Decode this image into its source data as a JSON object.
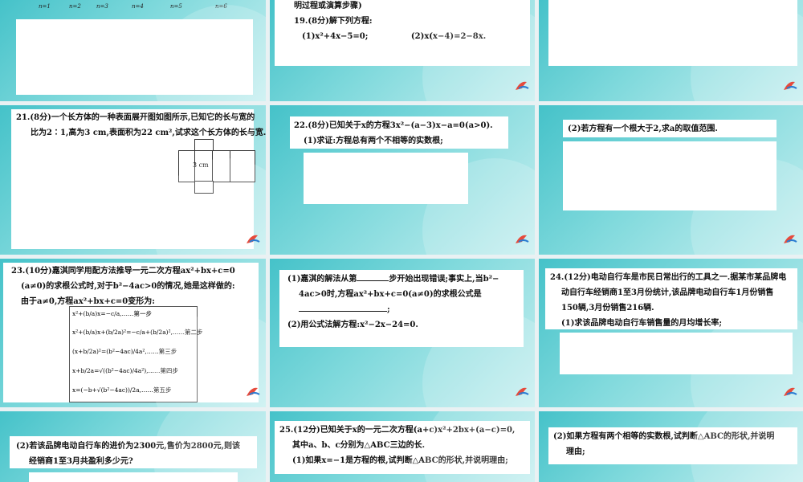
{
  "slide1": {
    "n_labels": [
      "n=1",
      "n=2",
      "n=3",
      "n=4",
      "n=5",
      "n=6"
    ]
  },
  "slide2": {
    "line1": "明过程或演算步骤)",
    "q19": "19.(8分)解下列方程:",
    "q19_1": "(1)x²+4x−5=0;",
    "q19_2": "(2)x(x−4)=2−8x."
  },
  "slide4": {
    "q21_l1": "21.(8分)一个长方体的一种表面展开图如图所示,已知它的长与宽的",
    "q21_l2": "比为2∶1,高为3 cm,表面积为22 cm²,试求这个长方体的长与宽.",
    "fig_label": "3 cm"
  },
  "slide5": {
    "q22": "22.(8分)已知关于x的方程3x²−(a−3)x−a=0(a>0).",
    "q22_1": "(1)求证:方程总有两个不相等的实数根;"
  },
  "slide6": {
    "q22_2": "(2)若方程有一个根大于2,求a的取值范围."
  },
  "slide7": {
    "q23_l1": "23.(10分)嘉淇同学用配方法推导一元二次方程ax²+bx+c=0",
    "q23_l2": "(a≠0)的求根公式时,对于b²−4ac>0的情况,她是这样做的:",
    "q23_l3": "由于a≠0,方程ax²+bx+c=0变形为:",
    "step1": "x²+(b/a)x=−c/a,……第一步",
    "step2": "x²+(b/a)x+(b/2a)²=−c/a+(b/2a)²,……第二步",
    "step3": "(x+b/2a)²=(b²−4ac)/4a²,……第三步",
    "step4": "x+b/2a=√((b²−4ac)/4a²),……第四步",
    "step5": "x=(−b+√(b²−4ac))/2a,……第五步"
  },
  "slide8": {
    "q23_1a": "(1)嘉淇的解法从第",
    "q23_1b": "步开始出现错误;事实上,当b²−",
    "q23_1c": "4ac>0时,方程ax²+bx+c=0(a≠0)的求根公式是",
    "q23_1d": ";",
    "q23_2": "(2)用公式法解方程:x²−2x−24=0."
  },
  "slide9": {
    "q24_l1": "24.(12分)电动自行车是市民日常出行的工具之一.据某市某品牌电",
    "q24_l2": "动自行车经销商1至3月份统计,该品牌电动自行车1月份销售",
    "q24_l3": "150辆,3月份销售216辆.",
    "q24_1": "(1)求该品牌电动自行车销售量的月均增长率;"
  },
  "slide10": {
    "q24_2a": "(2)若该品牌电动自行车的进价为2300元,售价为2800元,则该",
    "q24_2b": "经销商1至3月共盈利多少元?"
  },
  "slide11": {
    "q25_l1": "25.(12分)已知关于x的一元二次方程(a+c)x²+2bx+(a−c)=0,",
    "q25_l2": "其中a、b、c分别为△ABC三边的长.",
    "q25_1": "(1)如果x=−1是方程的根,试判断△ABC的形状,并说明理由;"
  },
  "slide12": {
    "q25_2a": "(2)如果方程有两个相等的实数根,试判断△ABC的形状,并说明",
    "q25_2b": "理由;"
  },
  "colors": {
    "teal": "#45c2c9",
    "light": "#c7eff0"
  }
}
